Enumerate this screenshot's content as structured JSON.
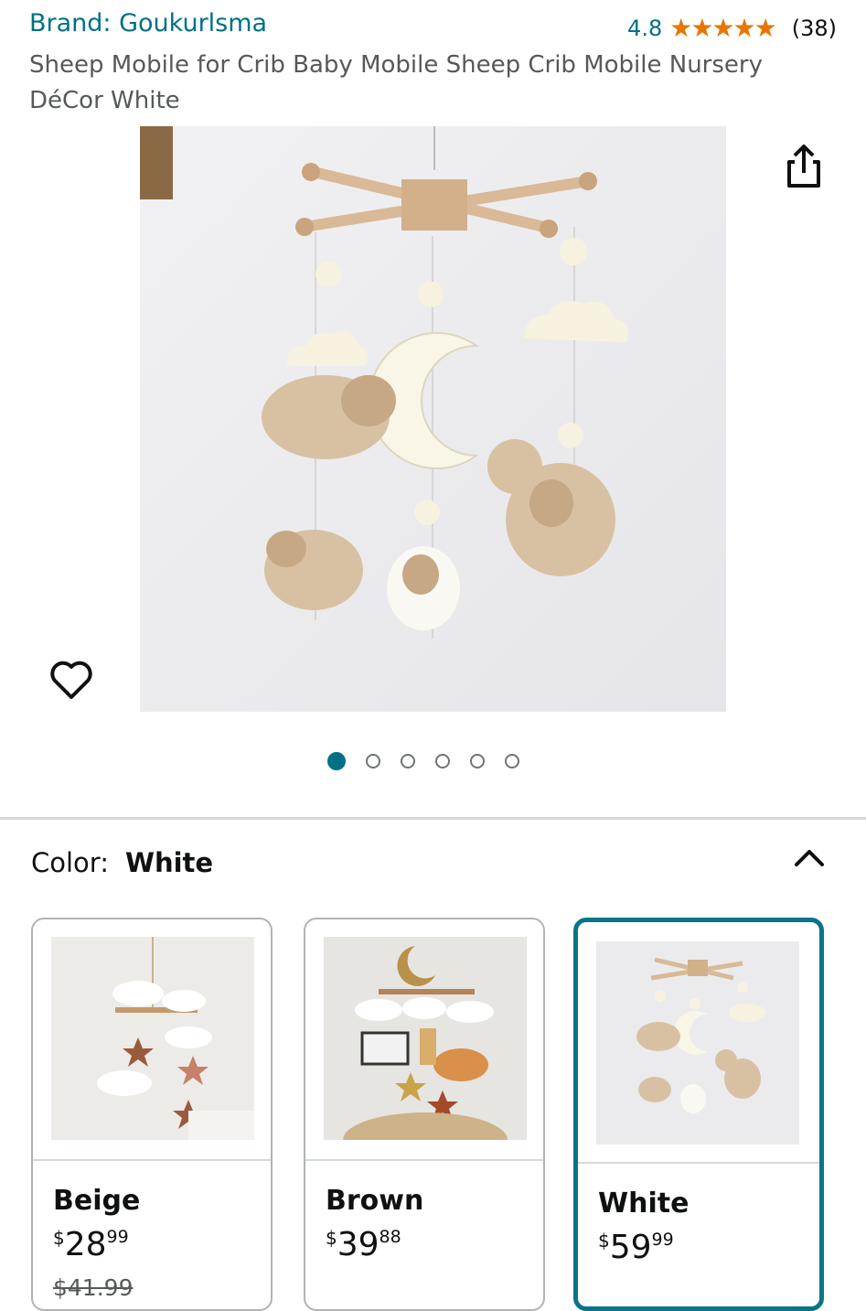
{
  "product": {
    "brand": "Brand: Goukurlsma",
    "rating": "4.8",
    "stars": "★★★★★",
    "review_count": "(38)",
    "title": "Sheep Mobile for Crib Baby Mobile Sheep Crib Mobile Nursery DéCor White"
  },
  "gallery": {
    "image_count": 6,
    "active_index": 0
  },
  "variation": {
    "label": "Color:",
    "selected": "White",
    "options": [
      {
        "name": "Beige",
        "currency": "$",
        "price_whole": "28",
        "price_frac": "99",
        "was_price": "$41.99"
      },
      {
        "name": "Brown",
        "currency": "$",
        "price_whole": "39",
        "price_frac": "88"
      },
      {
        "name": "White",
        "currency": "$",
        "price_whole": "59",
        "price_frac": "99"
      }
    ]
  },
  "colors": {
    "link": "#007185",
    "star": "#e77600",
    "selected_border": "#0a7488",
    "text": "#0f1111",
    "secondary": "#565959"
  },
  "icons": {
    "share": "share-icon",
    "wishlist": "heart-icon",
    "collapse": "chevron-up-icon"
  }
}
